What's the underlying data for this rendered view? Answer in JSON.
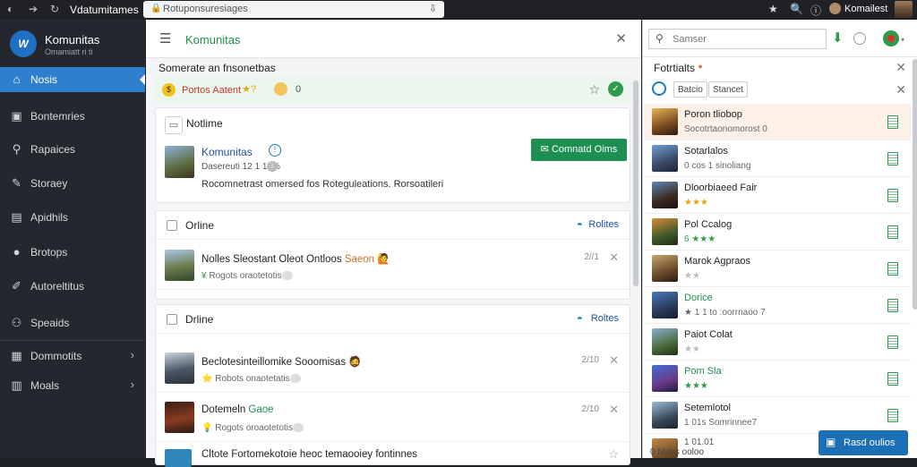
{
  "browser": {
    "tab_title": "Vdatumitames",
    "url": "Rotuponsuresiages",
    "profile_name": "Komailest"
  },
  "sidebar": {
    "brand": "Komunitas",
    "brand_sub": "Omamiatt ri ti",
    "items": [
      {
        "label": "Nosis",
        "icon": "home-icon"
      },
      {
        "label": "Bontemries",
        "icon": "briefcase-icon"
      },
      {
        "label": "Rapaices",
        "icon": "search-icon"
      },
      {
        "label": "Storaey",
        "icon": "pin-icon"
      },
      {
        "label": "Apidhils",
        "icon": "chart-icon"
      },
      {
        "label": "Brotops",
        "icon": "globe-icon"
      },
      {
        "label": "Autoreltitus",
        "icon": "pen-icon"
      },
      {
        "label": "Speaids",
        "icon": "people-icon"
      },
      {
        "label": "Dommotits",
        "icon": "calendar-icon"
      },
      {
        "label": "Moals",
        "icon": "book-icon"
      }
    ]
  },
  "main": {
    "title": "Komunitas",
    "section_title": "Somerate an fnsonetbas",
    "notice": {
      "text": "Portos Aatent",
      "stars": "★?",
      "count": "0"
    },
    "profile_card": {
      "header": "Notlime",
      "name": "Komunitas",
      "meta": "Dasereuti 12 1 12%",
      "meta_badge": "i",
      "description": "Rocomnetrast omersed  fos Roteguleations. Rorsoatileri",
      "cta": "Comnatd Oims"
    },
    "list_cards": [
      {
        "header": "Orline",
        "right_label": "Rolites",
        "rows": [
          {
            "title": "Nolles Sleostant Oleot Ontloos",
            "title_accent": "Saeon",
            "sub_prefix": "¥",
            "sub": "Rogots oraotetotis",
            "time": "2//1"
          }
        ]
      },
      {
        "header": "Drline",
        "right_label": "Roltes",
        "rows": [
          {
            "title": "Beclotesinteillomike Sooomisas",
            "title_accent": "",
            "sub_prefix": "⭐",
            "sub": "Robots onaotetatis",
            "time": "2/10"
          },
          {
            "title": "Dotemeln",
            "title_accent": "Gaoe",
            "sub_prefix": "💡",
            "sub": "Rogots oroaotetotis",
            "time": "2/10"
          },
          {
            "title": "Cltote Fortomekotoie heoc temaooiey fontinnes",
            "title_accent": "",
            "sub_prefix": "",
            "sub": "",
            "time": ""
          }
        ]
      }
    ]
  },
  "right": {
    "search_placeholder": "Samser",
    "title": "Fotrtialts",
    "chips": [
      "Batcio",
      "Stancet"
    ],
    "friends": [
      {
        "name": "Poron tliobop",
        "sub": "Socotrtaonomorost 0"
      },
      {
        "name": "Sotarlalos",
        "sub": "0 cos 1 sinoliang"
      },
      {
        "name": "Dloorbiaeed Fair",
        "sub": "★★★"
      },
      {
        "name": "Pol Ccalog",
        "sub": "6 ★★★"
      },
      {
        "name": "Marok Agpraos",
        "sub": "★★"
      },
      {
        "name": "Dorice",
        "sub": "★ 1 1 to :oorrnaoo 7"
      },
      {
        "name": "Paiot Colat",
        "sub": "★★"
      },
      {
        "name": "Pom Sla",
        "sub": "★★★"
      },
      {
        "name": "Setemlotol",
        "sub": "1 01s Somrinnee7"
      },
      {
        "name": "",
        "sub": "1 01.01"
      }
    ],
    "bottom_text": "0 Nslss ooloo",
    "fab_label": "Rasd oulios"
  },
  "colors": {
    "accent_blue": "#2f7fcf",
    "green": "#1d8f53",
    "sidebar_bg": "#24282e"
  }
}
